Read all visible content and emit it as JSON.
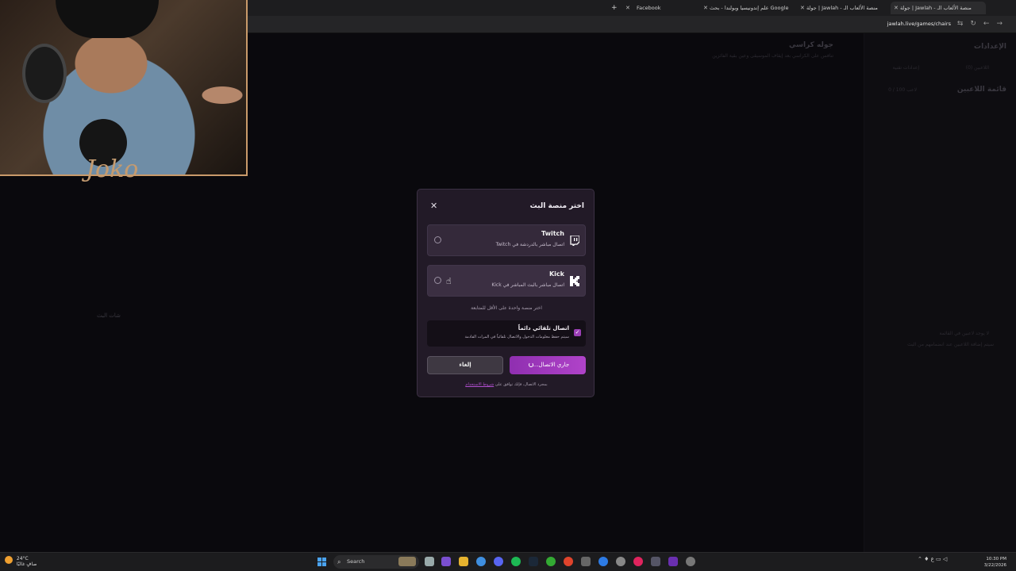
{
  "browser": {
    "tabs": [
      {
        "label": "جولة | Jawlah - منصة الألعاب الـ",
        "active": true
      },
      {
        "label": "جولة | Jawlah - منصة الألعاب الـ",
        "active": false
      },
      {
        "label": "علم إندونيسيا وبولندا - بحث Google",
        "active": false
      },
      {
        "label": "Facebook",
        "active": false
      }
    ],
    "url": "jawlah.live/games/chairs"
  },
  "background_app": {
    "game_title": "جوله كراسي",
    "game_subtitle": "تنافس على الكراسي بعد إيقاف الموسيقى وعين بقية الفائزين",
    "settings_label": "الإعدادات",
    "tab_players": "اللاعبين (0)",
    "tab_tech": "إعدادات تقنية",
    "players_list": "قائمة اللاعبين",
    "players_count": "0 / 100 لاعب",
    "stream_chat": "شات البث",
    "empty_title": "لا يوجد لاعبين في القائمة",
    "empty_desc": "سيتم إضافة اللاعبين عند انضمامهم من البث"
  },
  "modal": {
    "title": "اختر منصة البث",
    "options": [
      {
        "name": "Twitch",
        "desc": "اتصال مباشر بالدردشة في Twitch",
        "icon": "twitch-icon"
      },
      {
        "name": "Kick",
        "desc": "اتصال مباشر بالبث المباشر في Kick",
        "icon": "kick-icon"
      }
    ],
    "hint": "اختر منصة واحدة على الأقل للمتابعة",
    "auto_connect": {
      "title": "اتصال تلقائي دائماً",
      "desc": "سيتم حفظ معلومات الدخول والاتصال تلقائياً في المرات القادمة",
      "checked": true
    },
    "cancel_label": "إلغاء",
    "connect_label": "جاري الاتصال...",
    "terms_text": "بمجرد الاتصال، فإنك توافق على",
    "terms_link": "شروط الاستخدام",
    "accent_color": "#b043c9"
  },
  "webcam": {
    "signature": "Joko"
  },
  "taskbar": {
    "weather_temp": "24°C",
    "weather_desc": "صافٍ غالبًا",
    "search_label": "Search",
    "time": "10:30 PM",
    "date": "3/22/2026"
  }
}
